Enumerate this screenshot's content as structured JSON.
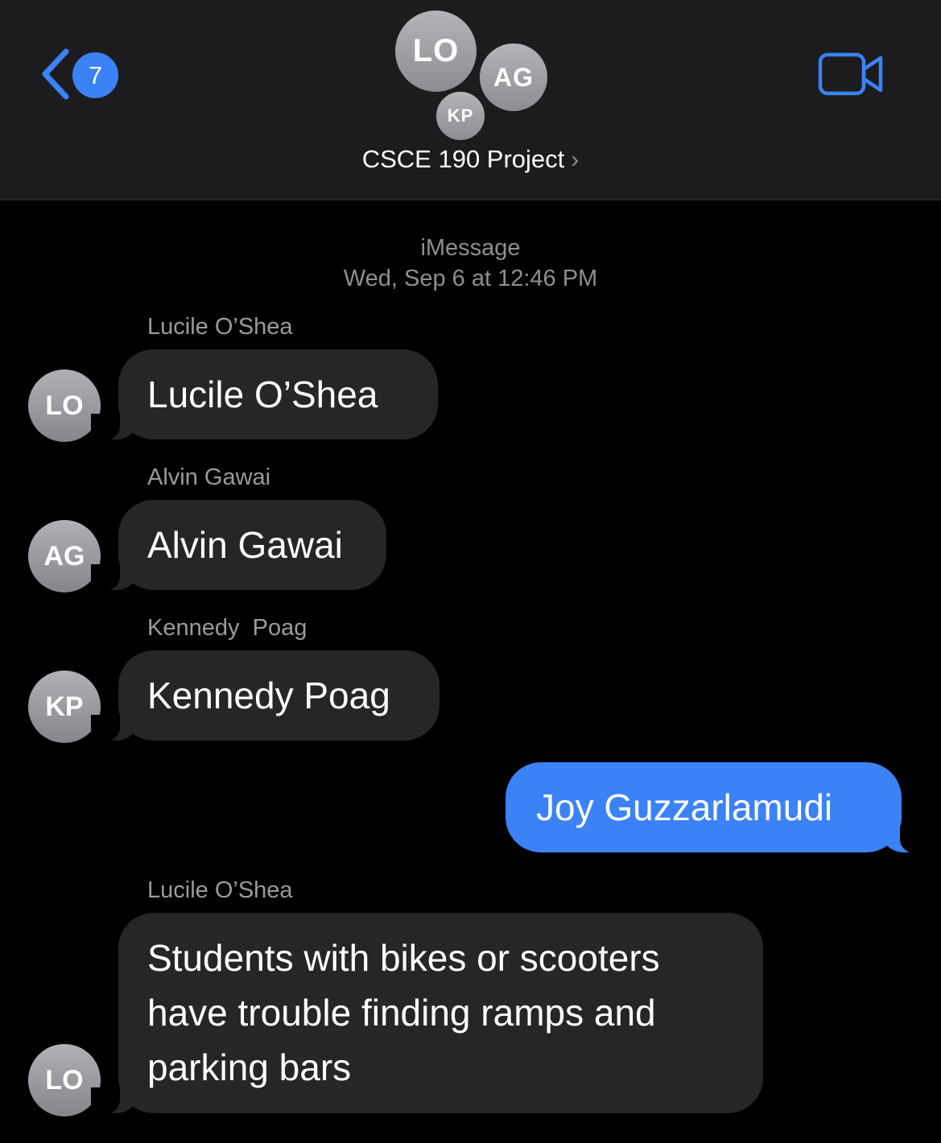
{
  "header": {
    "back_badge": "7",
    "avatars": [
      "LO",
      "AG",
      "KP"
    ],
    "title": "CSCE 190 Project",
    "title_chevron": "›",
    "video_icon": "video-camera-icon",
    "accent_color": "#3a82f6"
  },
  "service": {
    "name": "iMessage",
    "timestamp": "Wed, Sep 6 at 12:46 PM"
  },
  "messages": [
    {
      "sender": "Lucile O’Shea",
      "initials": "LO",
      "text": "Lucile O’Shea",
      "direction": "incoming"
    },
    {
      "sender": "Alvin Gawai",
      "initials": "AG",
      "text": "Alvin Gawai",
      "direction": "incoming"
    },
    {
      "sender": "Kennedy  Poag",
      "initials": "KP",
      "text": "Kennedy Poag",
      "direction": "incoming"
    },
    {
      "sender": "",
      "initials": "",
      "text": "Joy Guzzarlamudi",
      "direction": "outgoing"
    },
    {
      "sender": "Lucile O’Shea",
      "initials": "LO",
      "text": "Students with bikes or scooters have trouble finding ramps and parking bars",
      "direction": "incoming"
    }
  ]
}
